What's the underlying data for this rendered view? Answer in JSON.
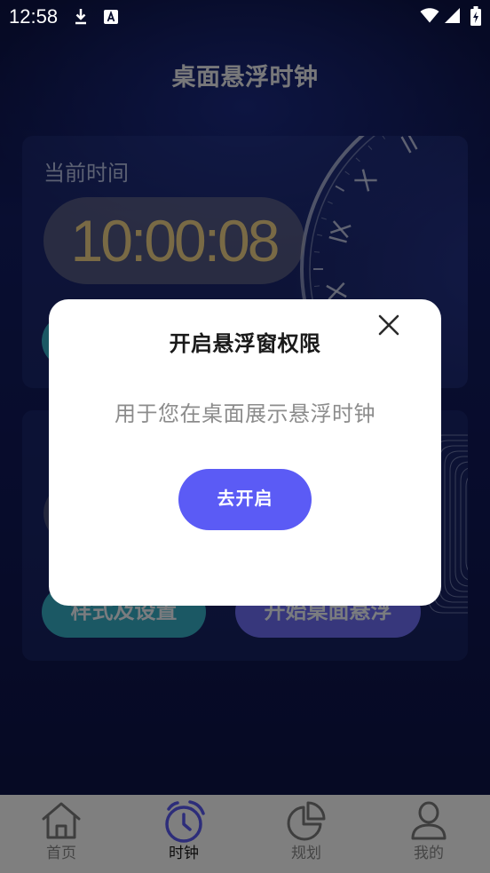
{
  "status_bar": {
    "time": "12:58",
    "left_icons": [
      "download-icon",
      "text-a-icon"
    ],
    "right_icons": [
      "wifi-icon",
      "cell-signal-icon",
      "battery-charging-icon"
    ]
  },
  "header": {
    "title": "桌面悬浮时钟"
  },
  "current_time_card": {
    "label": "当前时间",
    "time": "10:00:08",
    "decoration_icon": "clock-face-icon"
  },
  "float_card": {
    "style_settings_button": "样式及设置",
    "start_float_button": "开始桌面悬浮"
  },
  "dialog": {
    "title": "开启悬浮窗权限",
    "message": "用于您在桌面展示悬浮时钟",
    "confirm_button": "去开启",
    "close_icon": "close-icon"
  },
  "bottom_nav": {
    "active_index": 1,
    "items": [
      {
        "label": "首页",
        "icon": "home-icon"
      },
      {
        "label": "时钟",
        "icon": "alarm-clock-icon"
      },
      {
        "label": "规划",
        "icon": "pie-chart-icon"
      },
      {
        "label": "我的",
        "icon": "person-icon"
      }
    ]
  },
  "colors": {
    "accent": "#5b5bf5",
    "time_text": "#f2d58a",
    "style_button": "#36b0c8",
    "start_button": "#6e6ef8",
    "dialog_background": "#ffffff",
    "overlay": "rgba(0,0,0,0.5)"
  }
}
